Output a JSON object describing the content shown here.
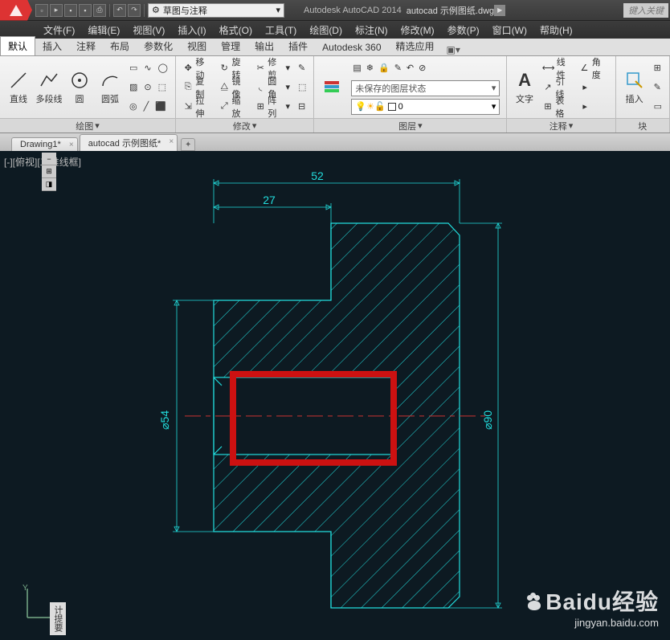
{
  "app": {
    "title": "Autodesk AutoCAD 2014",
    "filename": "autocad 示例图纸.dwg",
    "workspace": "草图与注释",
    "search_placeholder": "键入关键"
  },
  "menubar": [
    "文件(F)",
    "编辑(E)",
    "视图(V)",
    "插入(I)",
    "格式(O)",
    "工具(T)",
    "绘图(D)",
    "标注(N)",
    "修改(M)",
    "参数(P)",
    "窗口(W)",
    "帮助(H)"
  ],
  "ribbon_tabs": [
    "默认",
    "插入",
    "注释",
    "布局",
    "参数化",
    "视图",
    "管理",
    "输出",
    "插件",
    "Autodesk 360",
    "精选应用"
  ],
  "ribbon": {
    "draw_panel": {
      "title": "绘图",
      "items": [
        "直线",
        "多段线",
        "圆",
        "圆弧"
      ]
    },
    "grip_panel": {
      "items_row": [
        [
          "◫",
          "✦",
          "⬚"
        ],
        [
          "╱",
          "◐",
          "⊞"
        ],
        [
          "↗",
          "↘",
          "⬛"
        ]
      ]
    },
    "modify_panel": {
      "title": "修改",
      "rows": [
        [
          "移动",
          "旋转",
          "修剪"
        ],
        [
          "复制",
          "镜像",
          "圆角"
        ],
        [
          "拉伸",
          "缩放",
          "阵列"
        ]
      ]
    },
    "modify_icons_col": [
      "↙",
      "↔",
      "⊞"
    ],
    "layer_panel": {
      "title": "图层",
      "state": "未保存的图层状态",
      "current_layer": "0"
    },
    "annotation_panel": {
      "title": "注释",
      "text_btn": "文字",
      "rows": [
        [
          "线性",
          "角度"
        ],
        [
          "引线",
          ""
        ],
        [
          "表格",
          ""
        ]
      ]
    },
    "insert_panel": {
      "title": "块",
      "btn": "插入"
    }
  },
  "filetabs": [
    {
      "name": "Drawing1*",
      "active": false
    },
    {
      "name": "autocad 示例图纸*",
      "active": true
    }
  ],
  "viewport_label": "[-][俯视][二维线框]",
  "side_label": "计提要",
  "dimensions": {
    "top1": "52",
    "top2": "27",
    "left": "⌀54",
    "right": "⌀90"
  },
  "watermark": {
    "brand": "Baidu经验",
    "url": "jingyan.baidu.com"
  }
}
